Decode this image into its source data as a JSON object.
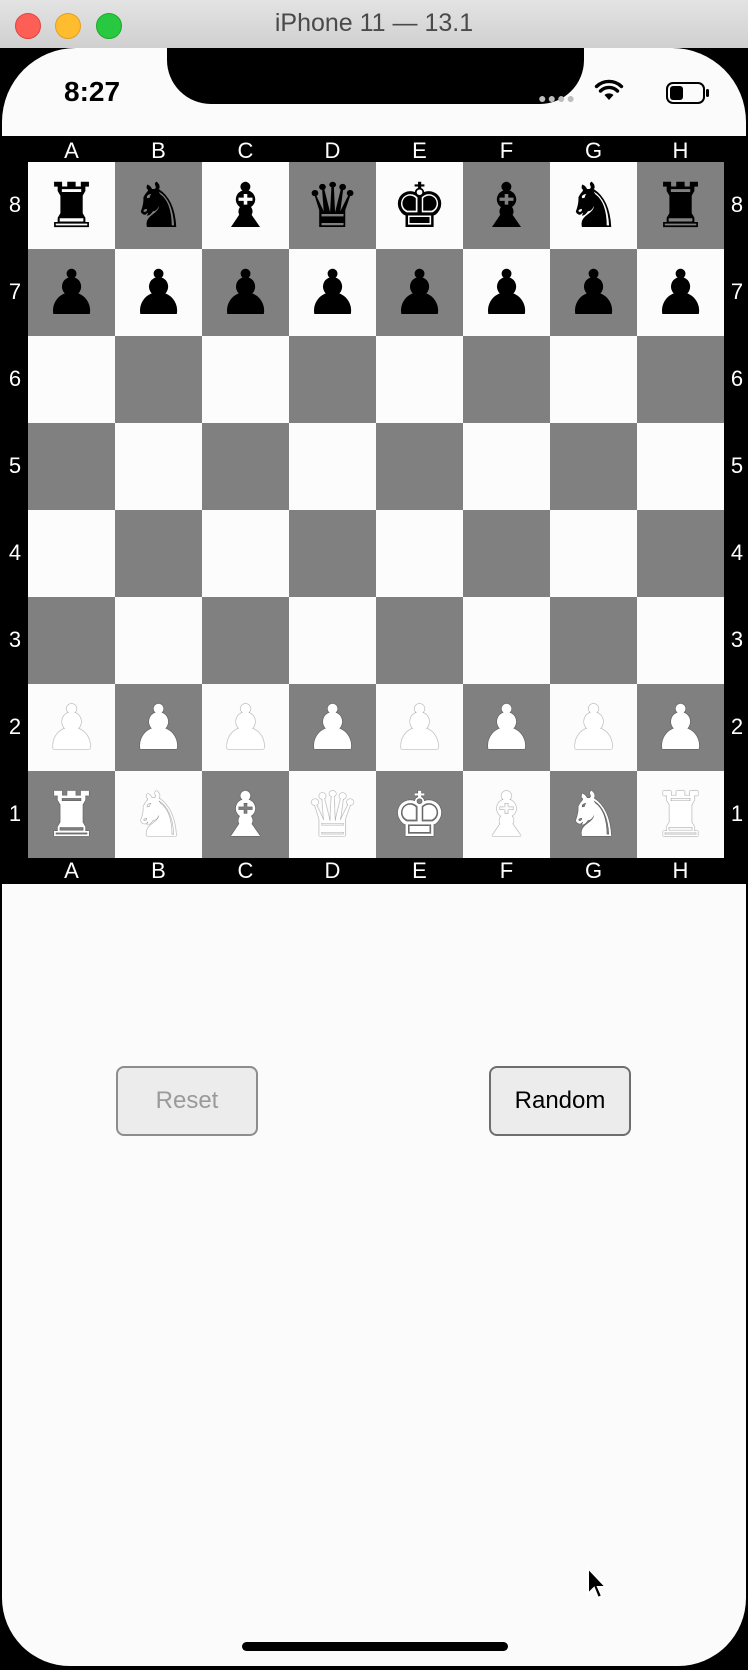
{
  "window": {
    "title": "iPhone 11 — 13.1"
  },
  "status_bar": {
    "time": "8:27",
    "signal": "●●●●"
  },
  "board": {
    "files": [
      "A",
      "B",
      "C",
      "D",
      "E",
      "F",
      "G",
      "H"
    ],
    "ranks": [
      "8",
      "7",
      "6",
      "5",
      "4",
      "3",
      "2",
      "1"
    ],
    "light_color": "#fcfcfc",
    "dark_color": "#808080",
    "position": [
      [
        "br",
        "bn",
        "bb",
        "bq",
        "bk",
        "bb",
        "bn",
        "br"
      ],
      [
        "bp",
        "bp",
        "bp",
        "bp",
        "bp",
        "bp",
        "bp",
        "bp"
      ],
      [
        "",
        "",
        "",
        "",
        "",
        "",
        "",
        ""
      ],
      [
        "",
        "",
        "",
        "",
        "",
        "",
        "",
        ""
      ],
      [
        "",
        "",
        "",
        "",
        "",
        "",
        "",
        ""
      ],
      [
        "",
        "",
        "",
        "",
        "",
        "",
        "",
        ""
      ],
      [
        "wp",
        "wp",
        "wp",
        "wp",
        "wp",
        "wp",
        "wp",
        "wp"
      ],
      [
        "wr",
        "wn",
        "wb",
        "wq",
        "wk",
        "wb",
        "wn",
        "wr"
      ]
    ]
  },
  "buttons": {
    "reset_label": "Reset",
    "random_label": "Random"
  },
  "icons": {
    "wifi": "wifi-icon",
    "battery": "battery-icon",
    "cursor": "mouse-pointer-icon"
  }
}
